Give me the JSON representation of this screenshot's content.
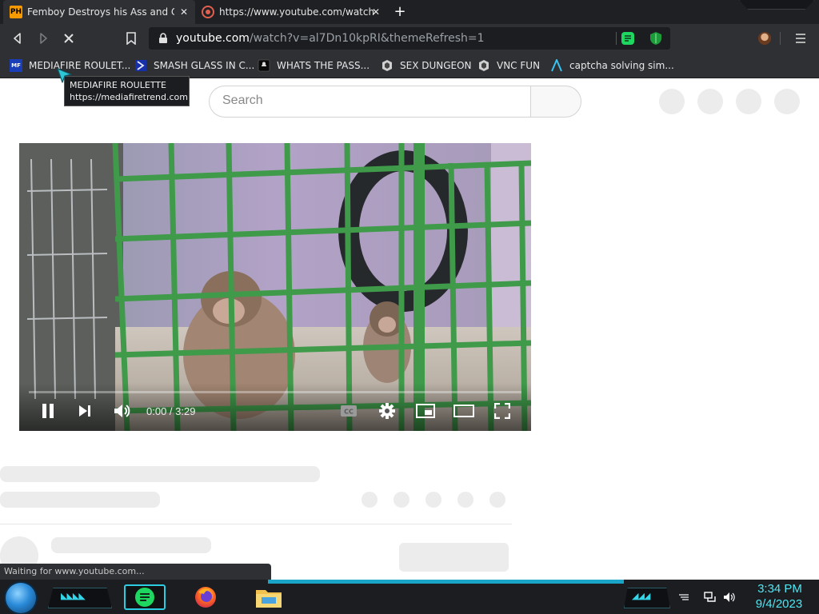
{
  "tabs": [
    {
      "title": "Femboy Destroys his Ass and Cum",
      "favicon_text": "PH",
      "favicon": "ph-favicon-icon",
      "active": true
    },
    {
      "title": "https://www.youtube.com/watch?v=",
      "favicon": "youtube-favicon-icon",
      "active": false
    }
  ],
  "url": {
    "host": "youtube.com",
    "path": "/watch?v=al7Dn10kpRI&themeRefresh=1"
  },
  "bookmarks": [
    {
      "label": "MEDIAFIRE ROULET...",
      "icon": "mediafire-icon",
      "icon_text": "MF"
    },
    {
      "label": "SMASH GLASS IN C...",
      "icon": "smash-glass-icon"
    },
    {
      "label": "WHATS THE PASS...",
      "icon": "whats-the-pass-icon"
    },
    {
      "label": "SEX DUNGEON",
      "icon": "dungeon-icon"
    },
    {
      "label": "VNC FUN",
      "icon": "vnc-icon"
    },
    {
      "label": "captcha solving sim...",
      "icon": "captcha-icon"
    }
  ],
  "tooltip": {
    "title": "MEDIAFIRE ROULETTE",
    "url": "https://mediafiretrend.com"
  },
  "search": {
    "placeholder": "Search"
  },
  "player": {
    "time": "0:00 / 3:29",
    "progress": 0.0,
    "state": "playing"
  },
  "status_bar": "Waiting for www.youtube.com...",
  "taskbar": {
    "time": "3:34 PM",
    "date": "9/4/2023"
  },
  "colors": {
    "accent_cyan": "#33d6e8",
    "chrome_bg": "#2e3033",
    "youtube_red": "#ff0000"
  }
}
